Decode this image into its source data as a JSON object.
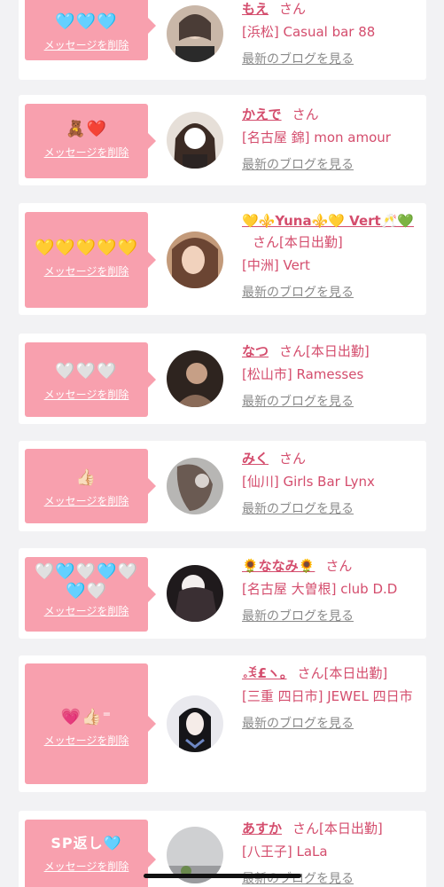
{
  "common": {
    "delete_label": "メッセージを削除",
    "blog_label": "最新のブログを見る",
    "san": "さん"
  },
  "colors": {
    "accent_pink": "#f8a0ae",
    "text_pink": "#d44d6d",
    "link_gray": "#8a8a8a",
    "background": "#f2f2f4"
  },
  "cards": [
    {
      "emoji": "🩵🩵🩵",
      "name": "もえ",
      "suffix": "さん",
      "shop": "[浜松] Casual bar 88"
    },
    {
      "emoji": "🧸❤️",
      "name": "かえで",
      "suffix": "さん",
      "shop": "[名古屋 錦] mon amour"
    },
    {
      "emoji": "💛💛💛💛💛",
      "name": "💛⚜️Yuna⚜️💛 Vert🥂💚",
      "suffix": "さん[本日出勤]",
      "shop": "[中洲] Vert"
    },
    {
      "emoji": "🤍🤍🤍",
      "name": "なつ",
      "suffix": "さん[本日出勤]",
      "shop": "[松山市] Ramesses"
    },
    {
      "emoji": "👍🏻",
      "name": "みく",
      "suffix": "さん",
      "shop": "[仙川] Girls Bar Lynx"
    },
    {
      "emoji": "🤍🩵🤍🩵🤍🩵🤍",
      "name": "🌻ななみ🌻",
      "suffix": "さん",
      "shop": "[名古屋 大曽根] club D.D"
    },
    {
      "emoji": "💗👍🏻⁼",
      "name": "｡ꉂ£ヽ｡",
      "suffix": "さん[本日出勤]",
      "shop": "[三重 四日市] JEWEL 四日市"
    },
    {
      "emoji": "SP返し🩵",
      "name": "あすか",
      "suffix": "さん[本日出勤]",
      "shop": "[八王子] LaLa"
    }
  ]
}
